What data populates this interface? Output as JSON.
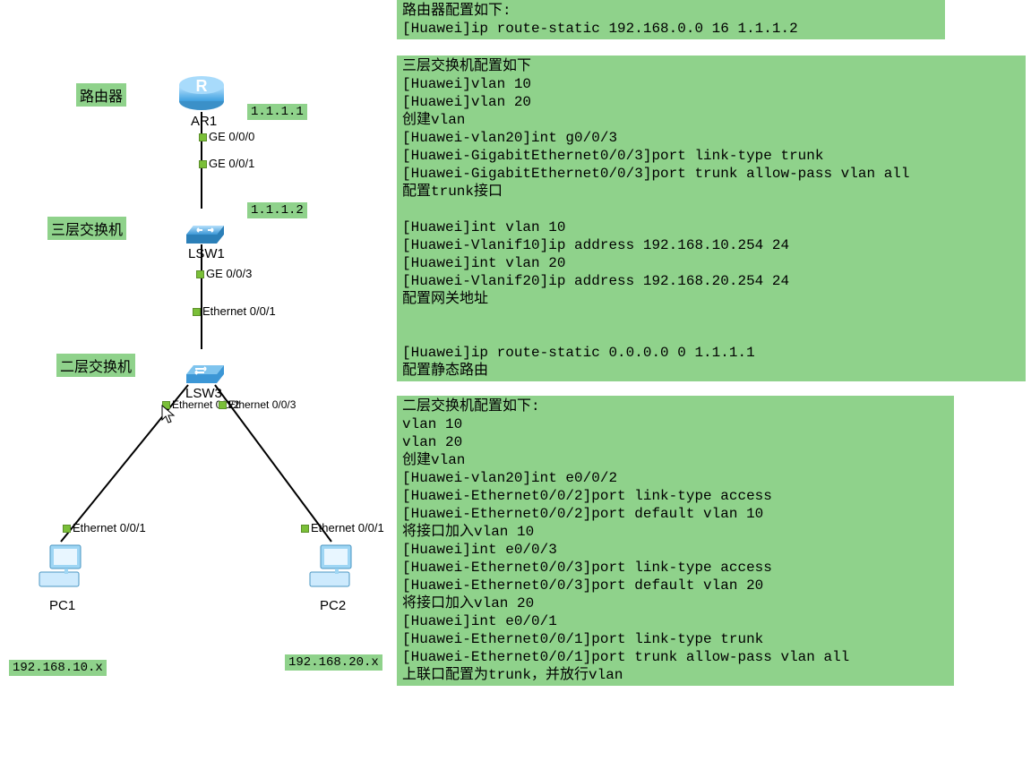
{
  "labels": {
    "router": "路由器",
    "l3switch": "三层交换机",
    "l2switch": "二层交换机"
  },
  "ips": {
    "ar1": "1.1.1.1",
    "lsw1": "1.1.1.2",
    "pc1": "192.168.10.x",
    "pc2": "192.168.20.x"
  },
  "devices": {
    "ar1": "AR1",
    "lsw1": "LSW1",
    "lsw3": "LSW3",
    "pc1": "PC1",
    "pc2": "PC2"
  },
  "ports": {
    "ar1_ge0": "GE 0/0/0",
    "lsw1_ge1": "GE 0/0/1",
    "lsw1_ge3": "GE 0/0/3",
    "lsw3_e1": "Ethernet 0/0/1",
    "lsw3_e2": "Ethernet 0/0/2",
    "lsw3_e3": "Ethernet 0/0/3",
    "pc1_e1": "Ethernet 0/0/1",
    "pc2_e1": "Ethernet 0/0/1"
  },
  "config": {
    "router": "路由器配置如下:\n[Huawei]ip route-static 192.168.0.0 16 1.1.1.2",
    "l3switch": "三层交换机配置如下\n[Huawei]vlan 10\n[Huawei]vlan 20\n创建vlan\n[Huawei-vlan20]int g0/0/3\n[Huawei-GigabitEthernet0/0/3]port link-type trunk\n[Huawei-GigabitEthernet0/0/3]port trunk allow-pass vlan all\n配置trunk接口\n\n[Huawei]int vlan 10\n[Huawei-Vlanif10]ip address 192.168.10.254 24\n[Huawei]int vlan 20\n[Huawei-Vlanif20]ip address 192.168.20.254 24\n配置网关地址\n\n\n[Huawei]ip route-static 0.0.0.0 0 1.1.1.1\n配置静态路由",
    "l2switch": "二层交换机配置如下:\nvlan 10\nvlan 20\n创建vlan\n[Huawei-vlan20]int e0/0/2\n[Huawei-Ethernet0/0/2]port link-type access\n[Huawei-Ethernet0/0/2]port default vlan 10\n将接口加入vlan 10\n[Huawei]int e0/0/3\n[Huawei-Ethernet0/0/3]port link-type access\n[Huawei-Ethernet0/0/3]port default vlan 20\n将接口加入vlan 20\n[Huawei]int e0/0/1\n[Huawei-Ethernet0/0/1]port link-type trunk\n[Huawei-Ethernet0/0/1]port trunk allow-pass vlan all\n上联口配置为trunk，并放行vlan"
  }
}
